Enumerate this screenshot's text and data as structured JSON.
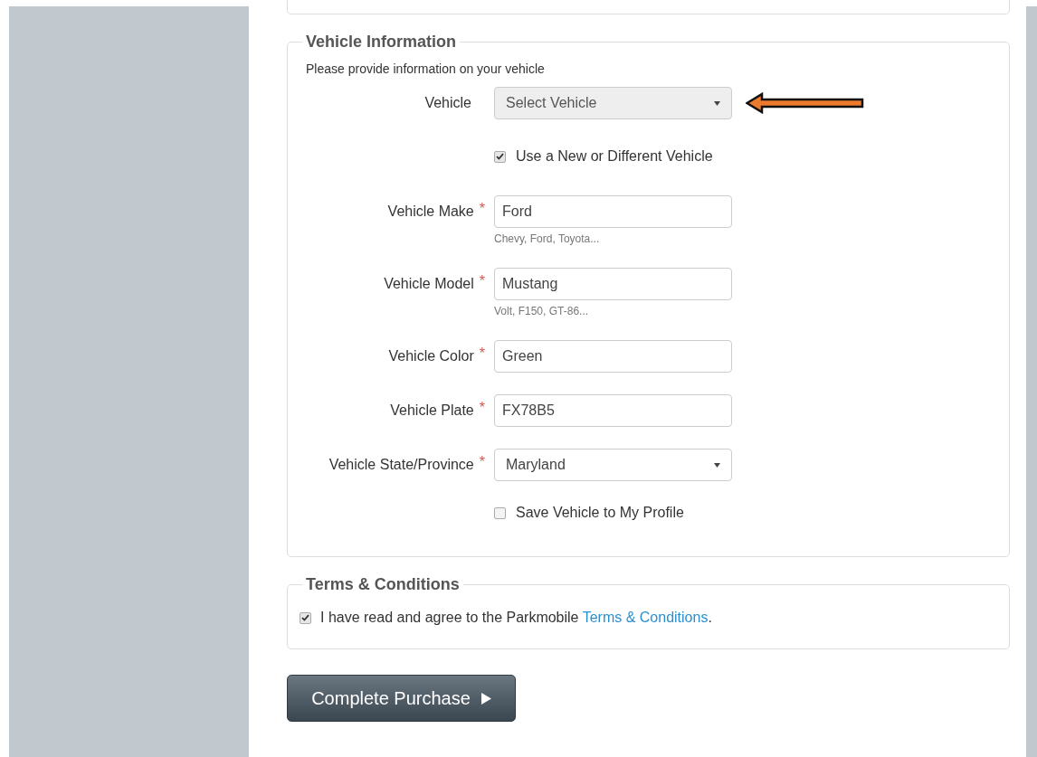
{
  "vehicle_information": {
    "legend": "Vehicle Information",
    "description": "Please provide information on your vehicle",
    "required_mark": "*",
    "rows": [
      {
        "kind": "select",
        "label": "Vehicle",
        "value": "Select Vehicle",
        "required": false,
        "disabled": true,
        "annotated": true
      },
      {
        "kind": "checkbox",
        "label": "Use a New or Different Vehicle",
        "checked": true
      },
      {
        "kind": "text",
        "label": "Vehicle Make",
        "value": "Ford",
        "required": true,
        "help": "Chevy, Ford, Toyota..."
      },
      {
        "kind": "text",
        "label": "Vehicle Model",
        "value": "Mustang",
        "required": true,
        "help": "Volt, F150, GT-86..."
      },
      {
        "kind": "text",
        "label": "Vehicle Color",
        "value": "Green",
        "required": true
      },
      {
        "kind": "text",
        "label": "Vehicle Plate",
        "value": "FX78B5",
        "required": true
      },
      {
        "kind": "select",
        "label": "Vehicle State/Province",
        "value": "Maryland",
        "required": true,
        "disabled": false,
        "annotated": false
      },
      {
        "kind": "checkbox",
        "label": "Save Vehicle to My Profile",
        "checked": false
      }
    ]
  },
  "terms": {
    "legend": "Terms & Conditions",
    "checked": true,
    "text": "I have read and agree to the Parkmobile ",
    "link": "Terms & Conditions",
    "after": "."
  },
  "submit": {
    "label": "Complete Purchase"
  }
}
